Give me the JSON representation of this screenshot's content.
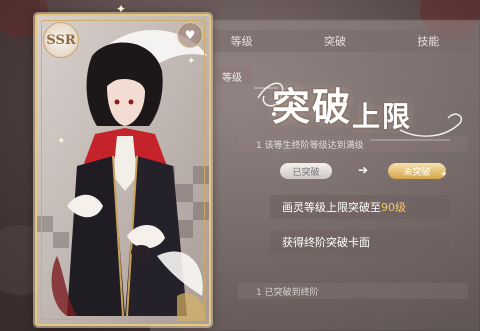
{
  "card": {
    "rarity": "SSR"
  },
  "tabs": [
    {
      "label": "等级"
    },
    {
      "label": "突破"
    },
    {
      "label": "技能"
    }
  ],
  "level_chip": "等级",
  "title": {
    "main": "突破",
    "rest": "上限"
  },
  "requirement": "1 该等生终阶等级达到满级",
  "breakthrough": {
    "from": "已突破",
    "to": "未突破"
  },
  "info": {
    "line1_prefix": "画灵等级上限突破至",
    "line1_value": "90级",
    "line2": "获得终阶突破卡面"
  },
  "bottom_note": "1 已突破到终阶",
  "colors": {
    "accent_gold": "#f3c66b",
    "card_border": "#e8c87a"
  }
}
